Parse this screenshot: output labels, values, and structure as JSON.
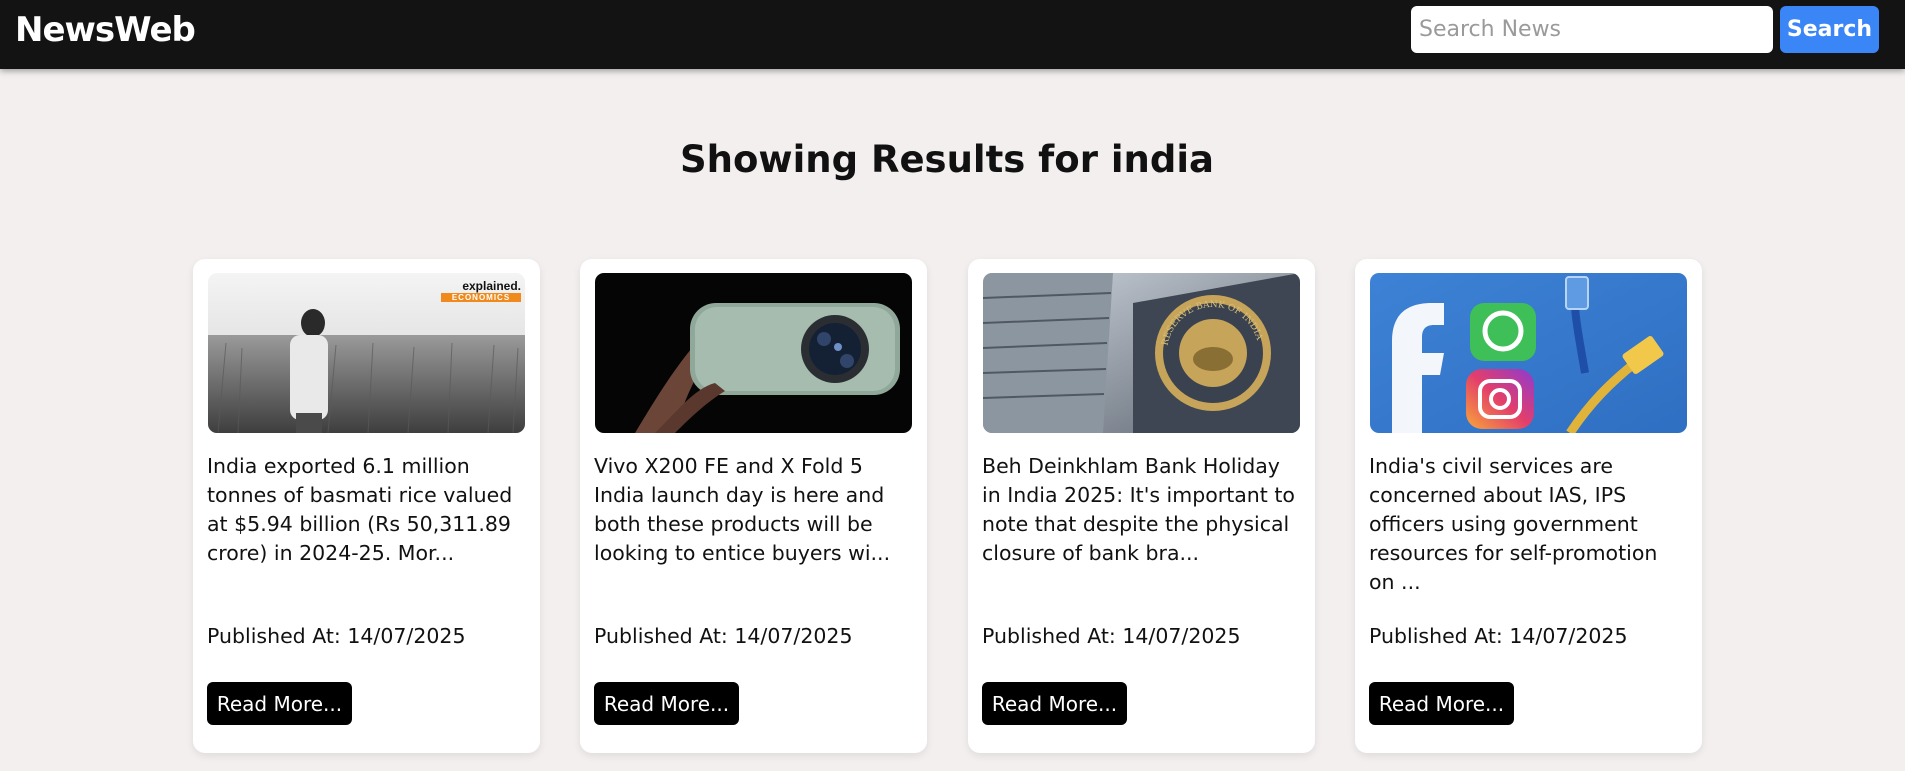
{
  "header": {
    "logo": "NewsWeb",
    "search_placeholder": "Search News",
    "search_label": "Search"
  },
  "results_heading": "Showing Results for india",
  "articles": [
    {
      "image_icon": "farmer-field-photo",
      "badge_top": "explained.",
      "badge_bottom": "ECONOMICS",
      "description": "India exported 6.1 million tonnes of basmati rice valued at $5.94 billion (Rs 50,311.89 crore) in 2024-25. Mor...",
      "published": "Published At: 14/07/2025",
      "read_more": "Read More..."
    },
    {
      "image_icon": "phone-camera-photo",
      "description": "Vivo X200 FE and X Fold 5 India launch day is here and both these products will be looking to entice buyers wi...",
      "published": "Published At: 14/07/2025",
      "read_more": "Read More..."
    },
    {
      "image_icon": "reserve-bank-building-photo",
      "seal_text": "RESERVE BANK OF INDIA",
      "description": "Beh Deinkhlam Bank Holiday in India 2025: It's important to note that despite the physical closure of bank bra...",
      "published": "Published At: 14/07/2025",
      "read_more": "Read More..."
    },
    {
      "image_icon": "social-media-cables-photo",
      "description": "India's civil services are concerned about IAS, IPS officers using government resources for self-promotion on ...",
      "published": "Published At: 14/07/2025",
      "read_more": "Read More..."
    }
  ]
}
